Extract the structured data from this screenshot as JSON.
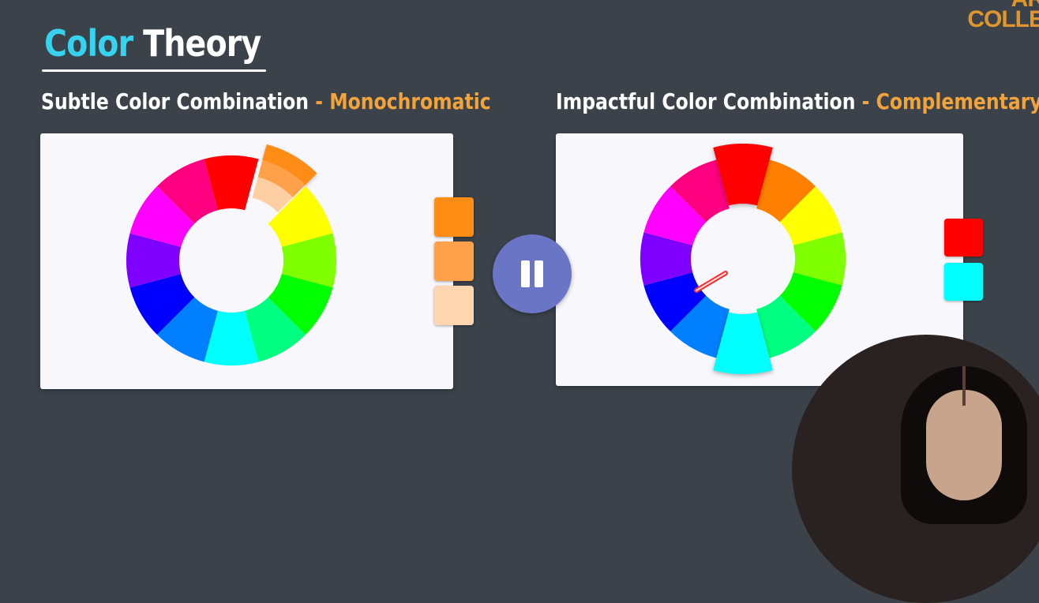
{
  "brand": {
    "line1": "AR",
    "line2": "COLLE"
  },
  "header": {
    "title_accent": "Color",
    "title_rest": "Theory"
  },
  "left": {
    "label": "Subtle Color Combination",
    "separator": "-",
    "kind": "Monochromatic",
    "wheel_colors": [
      "#ff0000",
      "#ff8000",
      "#ffff00",
      "#80ff00",
      "#00ff00",
      "#00ff80",
      "#00ffff",
      "#0080ff",
      "#0000ff",
      "#8000ff",
      "#ff00ff",
      "#ff0080"
    ],
    "highlight_index": 1,
    "highlight_shades": [
      "#ff8c14",
      "#ffa04a",
      "#ffcfa4"
    ],
    "swatches": [
      "#ff8c14",
      "#ffa04a",
      "#ffd6b0"
    ]
  },
  "right": {
    "label": "Impactful Color Combination",
    "separator": "-",
    "kind": "Complementary",
    "wheel_colors": [
      "#ff0000",
      "#ff8000",
      "#ffff00",
      "#80ff00",
      "#00ff00",
      "#00ff80",
      "#00ffff",
      "#0080ff",
      "#0000ff",
      "#8000ff",
      "#ff00ff",
      "#ff0080"
    ],
    "highlight_indices": [
      0,
      6
    ],
    "swatches": [
      "#ff0000",
      "#00ffff"
    ]
  },
  "controls": {
    "pause_label": "Pause"
  }
}
